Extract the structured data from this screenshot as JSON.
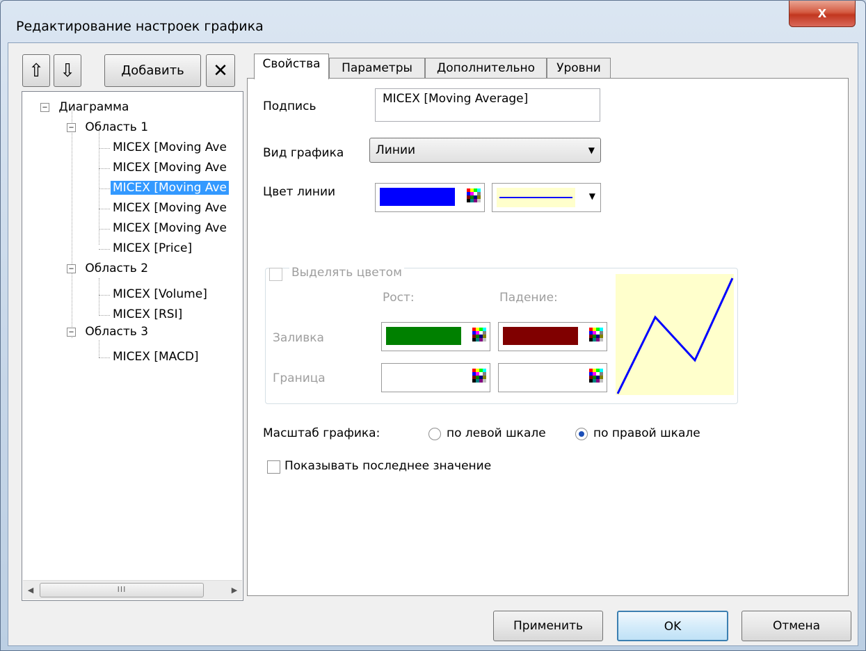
{
  "window": {
    "title": "Редактирование настроек графика",
    "close_label": "x"
  },
  "toolbar": {
    "up_arrow": "⇧",
    "down_arrow": "⇩",
    "add_label": "Добавить",
    "delete_glyph": "✕"
  },
  "tree": {
    "root": "Диаграмма",
    "area1": "Область 1",
    "area1_items": [
      "MICEX [Moving Ave",
      "MICEX [Moving Ave",
      "MICEX [Moving Ave",
      "MICEX [Moving Ave",
      "MICEX [Moving Ave",
      "MICEX [Price]"
    ],
    "area2": "Область 2",
    "area2_items": [
      "MICEX [Volume]",
      "MICEX [RSI]"
    ],
    "area3": "Область 3",
    "area3_items": [
      "MICEX [MACD]"
    ],
    "selected_index": 2,
    "scroll_thumb": "III"
  },
  "tabs": [
    {
      "label": "Свойства",
      "active": true
    },
    {
      "label": "Параметры",
      "active": false
    },
    {
      "label": "Дополнительно",
      "active": false
    },
    {
      "label": "Уровни",
      "active": false
    }
  ],
  "properties": {
    "caption_label": "Подпись",
    "caption_value": "MICEX [Moving Average]",
    "chart_type_label": "Вид графика",
    "chart_type_value": "Линии",
    "line_color_label": "Цвет линии",
    "line_color": "#0000ff",
    "line_preview_bg": "#ffffcc",
    "highlight_label": "Выделять цветом",
    "growth_label": "Рост:",
    "fall_label": "Падение:",
    "fill_label": "Заливка",
    "fill_growth_color": "#008000",
    "fill_fall_color": "#800000",
    "border_label": "Граница",
    "border_growth_color": "#ffffff",
    "border_fall_color": "#ffffff",
    "scale_label": "Масштаб графика:",
    "scale_left_label": "по левой шкале",
    "scale_right_label": "по правой шкале",
    "scale_selected": "right",
    "show_last_label": "Показывать последнее значение",
    "show_last_checked": false
  },
  "buttons": {
    "apply": "Применить",
    "ok": "OK",
    "cancel": "Отмена"
  }
}
